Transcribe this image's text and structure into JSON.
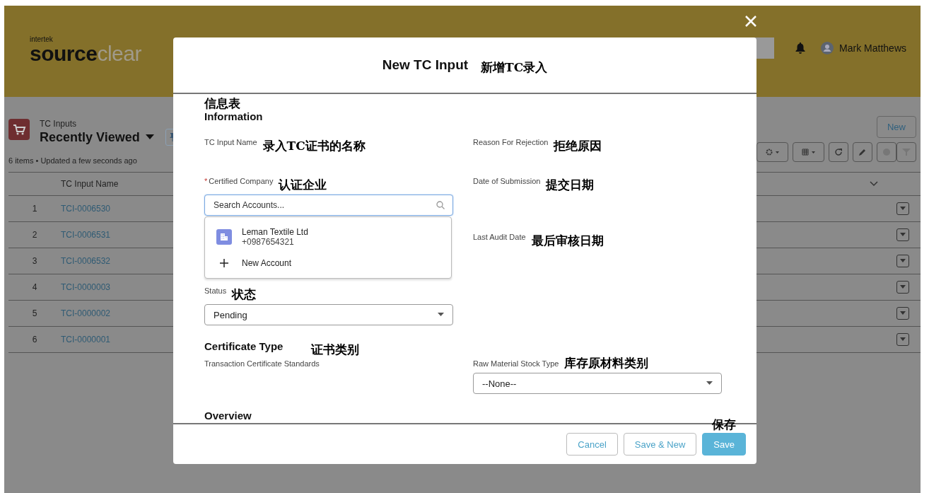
{
  "app": {
    "logo_small": "intertek",
    "logo_main": "source",
    "logo_accent": "clear",
    "user": "Mark Matthews"
  },
  "list_view": {
    "object": "TC Inputs",
    "view": "Recently Viewed",
    "summary": "6 items • Updated a few seconds ago",
    "new_button": "New",
    "columns": [
      "TC Input Name"
    ],
    "rows": [
      {
        "number": "1",
        "name": "TCI-0006530"
      },
      {
        "number": "2",
        "name": "TCI-0006531"
      },
      {
        "number": "3",
        "name": "TCI-0006532"
      },
      {
        "number": "4",
        "name": "TCI-0000003"
      },
      {
        "number": "5",
        "name": "TCI-0000002"
      },
      {
        "number": "6",
        "name": "TCI-0000001"
      }
    ]
  },
  "modal": {
    "title": "New TC Input",
    "title_note": "新增TC录入",
    "information": {
      "note": "信息表",
      "heading": "Information",
      "left": [
        {
          "kind": "text",
          "label": "TC Input Name",
          "note": "录入TC证书的名称"
        },
        {
          "kind": "lookup",
          "label": "Certified Company",
          "required_mark": "*",
          "note": "认证企业",
          "placeholder": "Search Accounts...",
          "results": [
            {
              "kind": "account",
              "name": "Leman Textile Ltd",
              "detail": "+0987654321"
            },
            {
              "kind": "new",
              "name": "New Account"
            }
          ]
        },
        {
          "kind": "picklist",
          "label": "Status",
          "note": "状态",
          "value": "Pending"
        }
      ],
      "right": [
        {
          "kind": "text",
          "label": "Reason For Rejection",
          "note": "拒绝原因"
        },
        {
          "kind": "date",
          "label": "Date of Submission",
          "note": "提交日期"
        },
        {
          "kind": "text",
          "label": "Last Audit Date",
          "note": "最后审核日期"
        }
      ]
    },
    "certificate": {
      "heading": "Certificate Type",
      "note": "证书类别",
      "left_label": "Transaction Certificate Standards",
      "right_label": "Raw Material Stock Type",
      "right_note": "库存原材料类别",
      "right_value": "--None--"
    },
    "overview": {
      "heading": "Overview"
    },
    "buttons": [
      {
        "kind": "neutral",
        "label": "Cancel"
      },
      {
        "kind": "neutral",
        "label": "Save & New"
      },
      {
        "kind": "brand",
        "label": "Save",
        "note": "保存"
      }
    ]
  }
}
